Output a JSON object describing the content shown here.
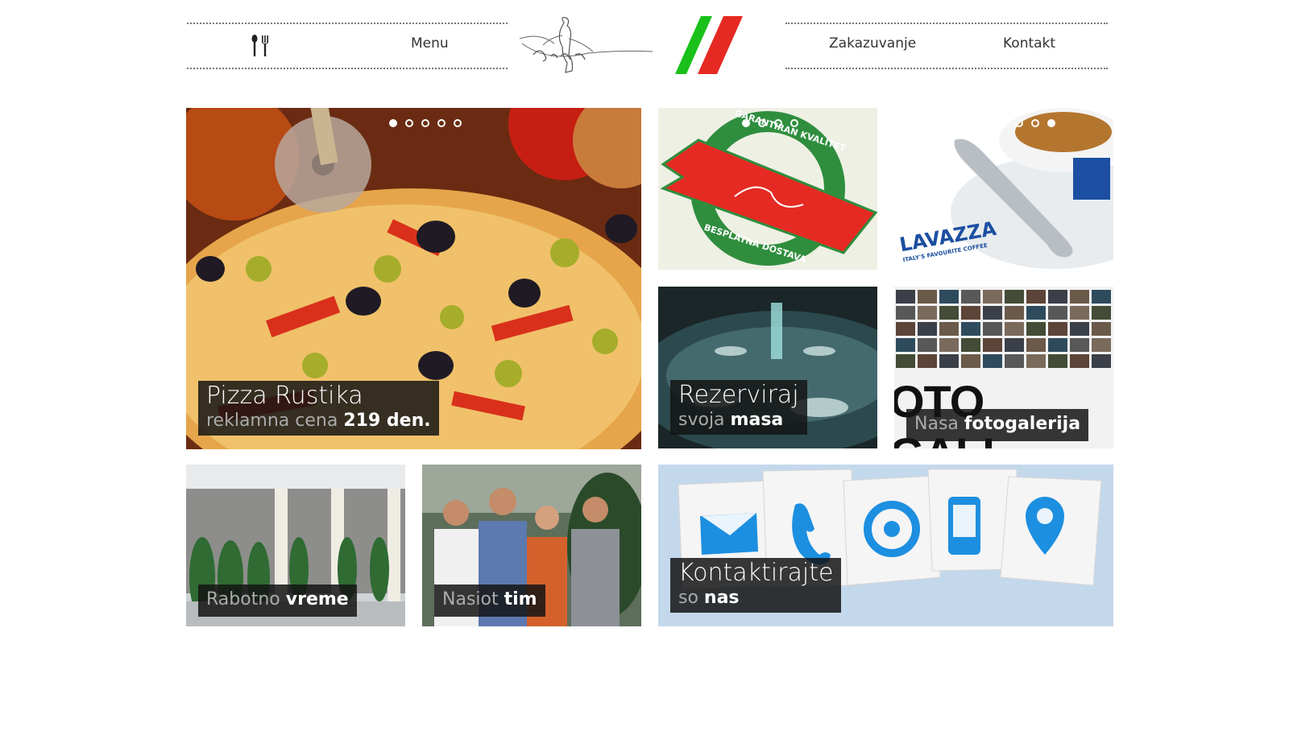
{
  "header": {
    "nav": {
      "menu": "Menu",
      "zakazuvanje": "Zakazuvanje",
      "kontakt": "Kontakt"
    },
    "logo_colors": [
      "#19c11a",
      "#ffffff",
      "#e52a23"
    ]
  },
  "tiles": {
    "pizza": {
      "title": "Pizza Rustika",
      "sub_light": "reklamna cena",
      "sub_bold": "219 den.",
      "active_slide": 1,
      "slides": 5
    },
    "quality": {
      "stamp_top": "GARANTIRAN KVALITET",
      "stamp_bottom": "BESPLATNA DOSTAVA",
      "active_slide": 1,
      "slides": 4
    },
    "coffee": {
      "brand": "LAVAZZA",
      "tagline": "ITALY'S FAVOURITE COFFEE",
      "active_slide": 4,
      "slides": 4
    },
    "reserve": {
      "title": "Rezerviraj",
      "sub_light": "svoja",
      "sub_bold": "masa"
    },
    "gallery": {
      "banner": "OTO GALL",
      "sub_light": "Nasa",
      "sub_bold": "fotogalerija"
    },
    "hours": {
      "sub_light": "Rabotno",
      "sub_bold": "vreme"
    },
    "team": {
      "sub_light": "Nasiot",
      "sub_bold": "tim"
    },
    "contact": {
      "title": "Kontaktirajte",
      "sub_light": "so",
      "sub_bold": "nas"
    }
  }
}
